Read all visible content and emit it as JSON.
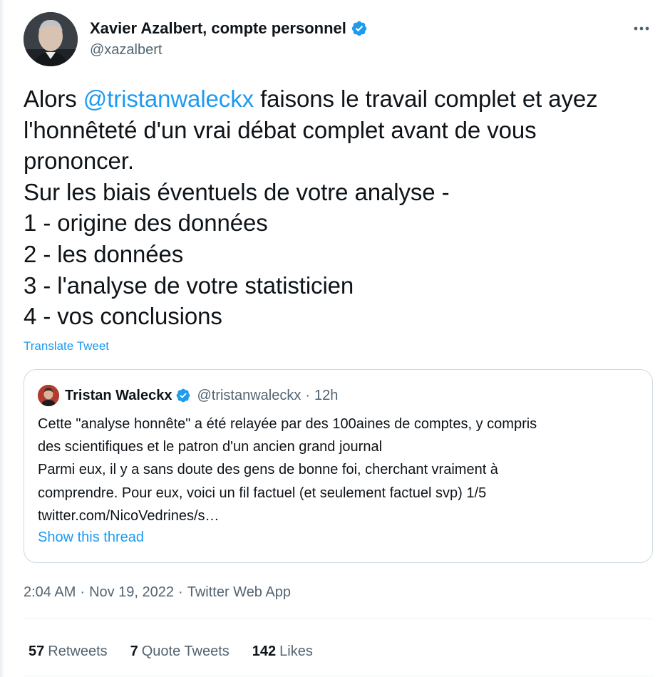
{
  "author": {
    "name": "Xavier Azalbert, compte personnel",
    "handle": "@xazalbert",
    "verified": true
  },
  "tweet": {
    "lines": [
      {
        "before": "Alors ",
        "mention": "@tristanwaleckx",
        "after": " faisons le travail complet et ayez"
      },
      "l'honnêteté d'un vrai débat complet avant de vous",
      "prononcer.",
      "Sur les biais éventuels de votre analyse -",
      "1 - origine des données",
      "2 - les données",
      "3 - l'analyse de votre statisticien",
      "4 - vos conclusions"
    ],
    "translate_label": "Translate Tweet"
  },
  "quote": {
    "name": "Tristan Waleckx",
    "handle": "@tristanwaleckx",
    "separator": "·",
    "time": "12h",
    "lines": [
      "Cette \"analyse honnête\" a été relayée par des 100aines de comptes, y compris",
      "des scientifiques et le patron d'un ancien grand journal",
      "Parmi eux, il y a sans doute des gens de bonne foi, cherchant vraiment à",
      "comprendre. Pour eux, voici un fil factuel (et seulement factuel svp) 1/5",
      "twitter.com/NicoVedrines/s…"
    ],
    "show_thread_label": "Show this thread"
  },
  "meta": {
    "time": "2:04 AM",
    "separator": "·",
    "date": "Nov 19, 2022",
    "source": "Twitter Web App"
  },
  "stats": {
    "retweets": {
      "count": "57",
      "label": "Retweets"
    },
    "quote_tweets": {
      "count": "7",
      "label": "Quote Tweets"
    },
    "likes": {
      "count": "142",
      "label": "Likes"
    }
  },
  "icons": {
    "more": "more-horizontal-icon",
    "verified": "verified-badge-icon"
  },
  "colors": {
    "accent": "#1d9bf0",
    "text_primary": "#0f1419",
    "text_secondary": "#536471",
    "border": "#cfd9de"
  }
}
